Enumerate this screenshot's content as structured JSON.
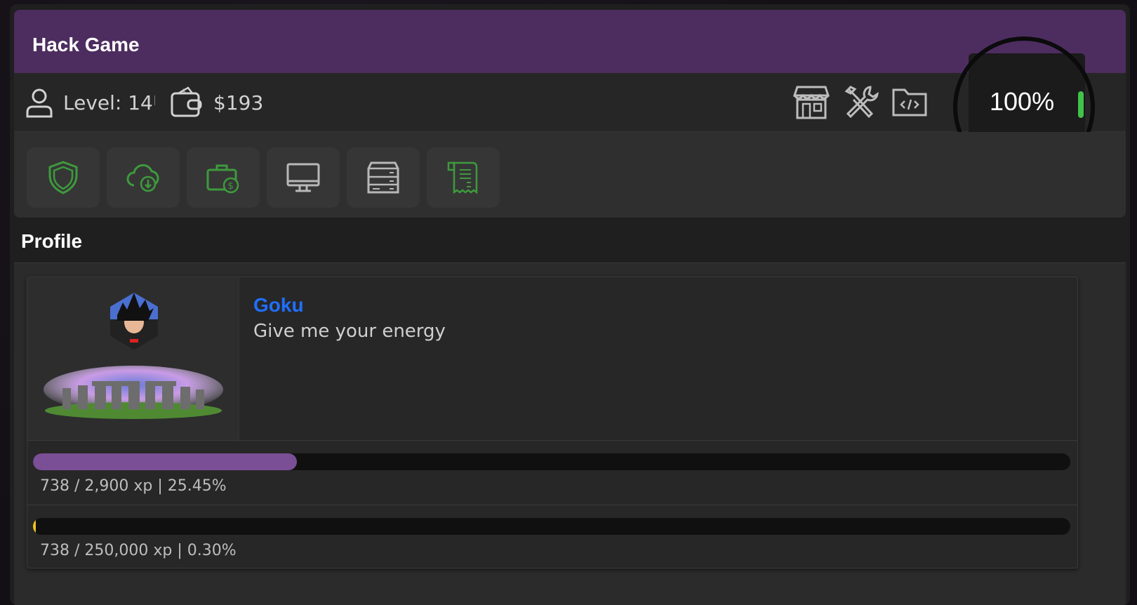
{
  "window": {
    "title": "Hack Game"
  },
  "status": {
    "level_label": "Level: 14",
    "money_label": "$193",
    "battery_percent": "100%",
    "icons": [
      "user-icon",
      "wallet-icon",
      "store-icon",
      "tools-icon",
      "code-folder-icon",
      "battery-icon"
    ]
  },
  "apps": [
    {
      "name": "shield-icon",
      "color": "#3d9a3d"
    },
    {
      "name": "cloud-download-icon",
      "color": "#3d9a3d"
    },
    {
      "name": "briefcase-money-icon",
      "color": "#3d9a3d"
    },
    {
      "name": "monitor-icon",
      "color": "#b8b8b8"
    },
    {
      "name": "server-icon",
      "color": "#b8b8b8"
    },
    {
      "name": "receipt-icon",
      "color": "#3d9a3d"
    }
  ],
  "section": {
    "title": "Profile"
  },
  "profile": {
    "name": "Goku",
    "status": "Give me your energy"
  },
  "progress": {
    "level": {
      "text": "738 / 2,900 xp | 25.45%",
      "fraction": 0.2545,
      "color": "#7a4f95"
    },
    "total": {
      "text": "738 / 250,000 xp | 0.30%",
      "fraction": 0.003,
      "color": "#f0c419"
    }
  },
  "colors": {
    "titlebar": "#4d2d5f",
    "accent_name": "#1f6fff",
    "battery_green": "#41c24a"
  }
}
